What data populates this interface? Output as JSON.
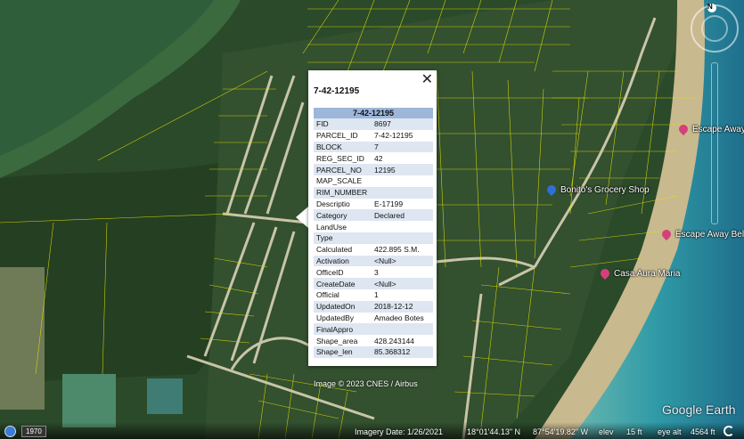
{
  "popup": {
    "title": "7-42-12195",
    "table_header": "7-42-12195",
    "close_label": "✕",
    "fields": [
      {
        "key": "FID",
        "value": "8697"
      },
      {
        "key": "PARCEL_ID",
        "value": "7-42-12195"
      },
      {
        "key": "BLOCK",
        "value": "7"
      },
      {
        "key": "REG_SEC_ID",
        "value": "42"
      },
      {
        "key": "PARCEL_NO",
        "value": "12195"
      },
      {
        "key": "MAP_SCALE",
        "value": ""
      },
      {
        "key": "RIM_NUMBER",
        "value": ""
      },
      {
        "key": "Descriptio",
        "value": "E-17199"
      },
      {
        "key": "Category",
        "value": "Declared"
      },
      {
        "key": "LandUse",
        "value": ""
      },
      {
        "key": "Type",
        "value": ""
      },
      {
        "key": "Calculated",
        "value": "422.895 S.M."
      },
      {
        "key": "Activation",
        "value": "<Null>"
      },
      {
        "key": "OfficeID",
        "value": "3"
      },
      {
        "key": "CreateDate",
        "value": "<Null>"
      },
      {
        "key": "Official",
        "value": "1"
      },
      {
        "key": "UpdatedOn",
        "value": "2018-12-12"
      },
      {
        "key": "UpdatedBy",
        "value": "Amadeo Botes"
      },
      {
        "key": "FinalAppro",
        "value": ""
      },
      {
        "key": "Shape_area",
        "value": "428.243144"
      },
      {
        "key": "Shape_len",
        "value": "85.368312"
      }
    ]
  },
  "places": [
    {
      "label": "Bonito's Grocery Shop",
      "icon": "blue-pin-icon",
      "color": "#2f6fd6"
    },
    {
      "label": "Escape Away Co",
      "icon": "pink-pin-icon",
      "color": "#d6407a"
    },
    {
      "label": "Escape Away Bel",
      "icon": "pink-pin-icon",
      "color": "#d6407a"
    },
    {
      "label": "Casa Aura Maria",
      "icon": "pink-pin-icon",
      "color": "#d6407a"
    }
  ],
  "map": {
    "credit": "Image © 2023 CNES / Airbus",
    "logo": "Google Earth",
    "compass": "N",
    "historical_year": "1970"
  },
  "status": {
    "imagery_date": "Imagery Date: 1/26/2021",
    "lat": "18°01'44.13\" N",
    "lon": "87°54'19.82\" W",
    "elev_label": "elev",
    "elev_value": "15 ft",
    "eye_alt_label": "eye alt",
    "eye_alt_value": "4564 ft"
  },
  "colors": {
    "parcel_lines": "#e6e600",
    "vegetation": "#2d4f2b",
    "sea": "#3fa5a8",
    "beach": "#c8b68a",
    "popup_header": "#9db6d9"
  }
}
